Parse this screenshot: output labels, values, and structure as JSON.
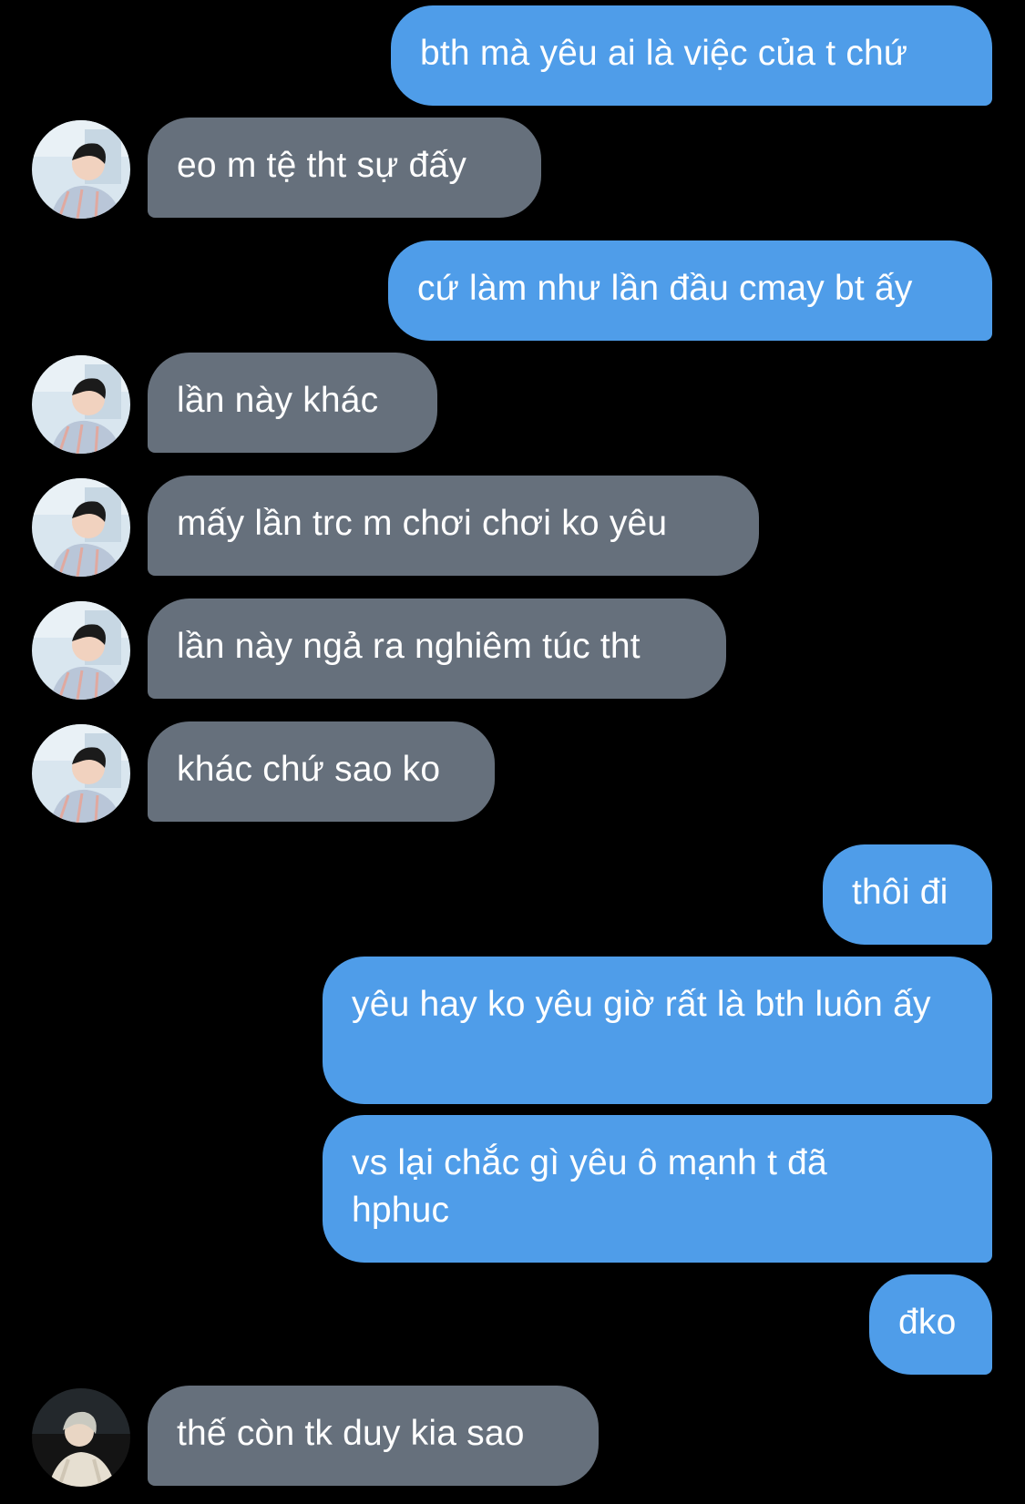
{
  "conversation": {
    "messages": [
      {
        "direction": "outgoing",
        "text": "bth mà yêu ai là việc của t chứ"
      },
      {
        "direction": "incoming",
        "text": "eo m tệ tht sự đấy",
        "avatar": "contact-avatar-icon"
      },
      {
        "direction": "outgoing",
        "text": "cứ làm như lần đầu cmay bt ấy"
      },
      {
        "direction": "incoming",
        "text": "lần này khác",
        "avatar": "contact-avatar-icon"
      },
      {
        "direction": "incoming",
        "text": "mấy lần trc m chơi chơi ko yêu",
        "avatar": "contact-avatar-icon"
      },
      {
        "direction": "incoming",
        "text": "lần này ngả ra nghiêm túc tht",
        "avatar": "contact-avatar-icon"
      },
      {
        "direction": "incoming",
        "text": "khác chứ sao ko",
        "avatar": "contact-avatar-icon"
      },
      {
        "direction": "outgoing",
        "text": "thôi đi"
      },
      {
        "direction": "outgoing",
        "text": "yêu hay ko yêu giờ rất là bth luôn ấy"
      },
      {
        "direction": "outgoing",
        "text": "vs lại chắc gì yêu ô mạnh t đã hphuc"
      },
      {
        "direction": "outgoing",
        "text": "đko"
      },
      {
        "direction": "incoming",
        "text": "thế còn tk duy kia sao",
        "avatar": "contact-avatar-dark-icon"
      }
    ]
  },
  "colors": {
    "background": "#000000",
    "outgoing_bubble": "#4f9de9",
    "incoming_bubble": "#66707c",
    "text": "#ffffff"
  }
}
